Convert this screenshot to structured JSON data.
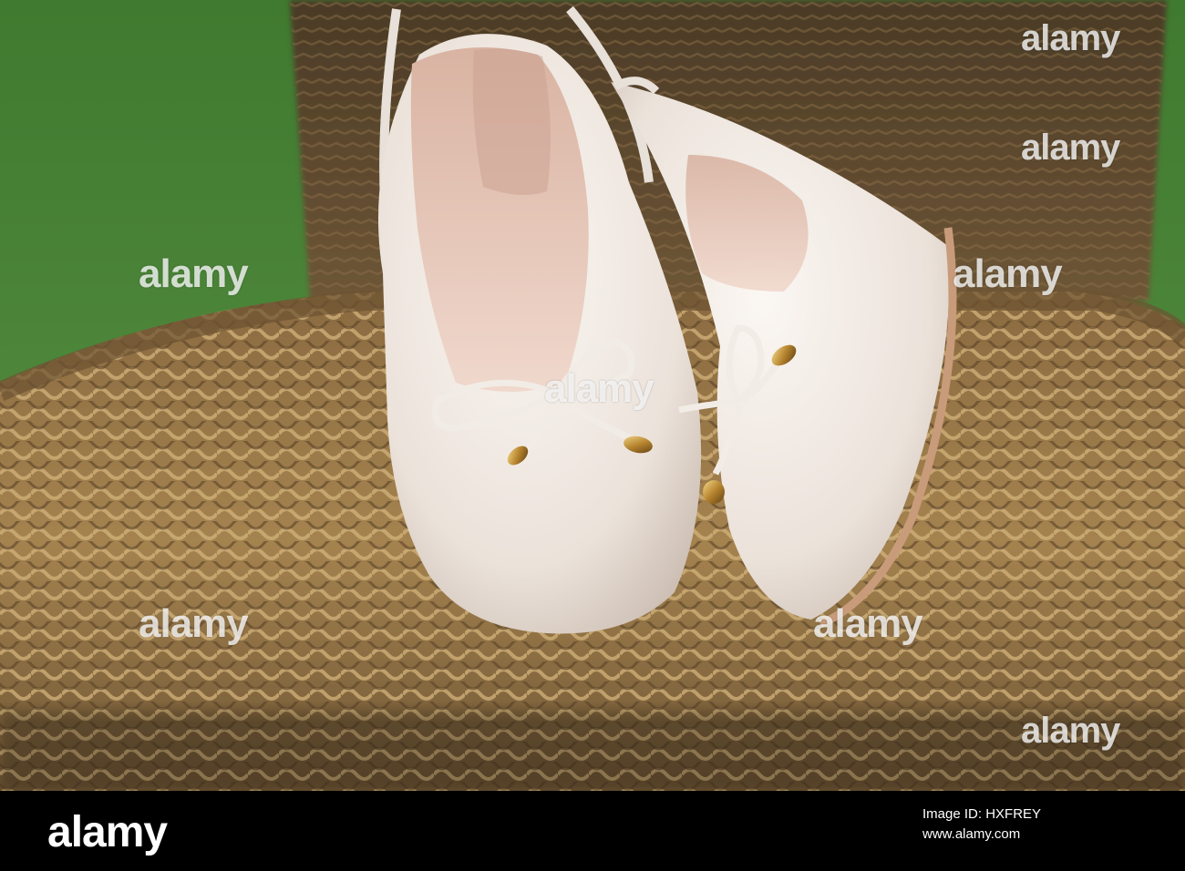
{
  "photo": {
    "description_colors": {
      "grass": "#4f8a3a",
      "wicker": "#9c7a4e",
      "shoe": "#efe8e2",
      "lining": "#e6c9bb",
      "metal_tip": "#c9a14a"
    }
  },
  "watermark": {
    "text": "alamy"
  },
  "footer": {
    "logo": "alamy",
    "image_id": "Image ID: HXFREY",
    "url": "www.alamy.com"
  },
  "colors": {
    "footer_bg": "#000000",
    "footer_text": "#ffffff"
  }
}
